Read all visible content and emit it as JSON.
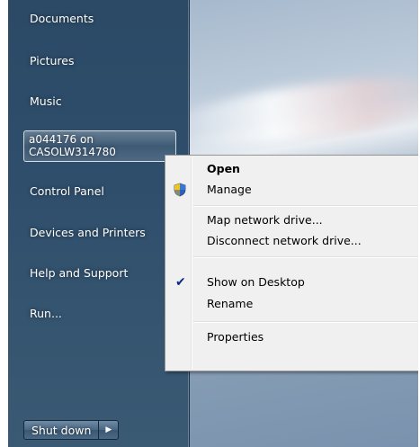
{
  "start_menu": {
    "items": [
      {
        "label": "Documents"
      },
      {
        "label": "Pictures"
      },
      {
        "label": "Music"
      },
      {
        "label_line1": "a044176 on",
        "label_line2": "CASOLW314780"
      },
      {
        "label": "Control Panel"
      },
      {
        "label": "Devices and Printers"
      },
      {
        "label": "Help and Support"
      },
      {
        "label": "Run..."
      }
    ],
    "shutdown_label": "Shut down",
    "shutdown_arrow": "▶"
  },
  "context_menu": {
    "items": [
      {
        "label": "Open",
        "bold": true
      },
      {
        "label": "Manage",
        "icon": "shield-icon"
      },
      {
        "label": "Map network drive..."
      },
      {
        "label": "Disconnect network drive..."
      },
      {
        "label": "Show on Desktop",
        "checked": true
      },
      {
        "label": "Rename"
      },
      {
        "label": "Properties"
      }
    ],
    "check_glyph": "✔"
  }
}
